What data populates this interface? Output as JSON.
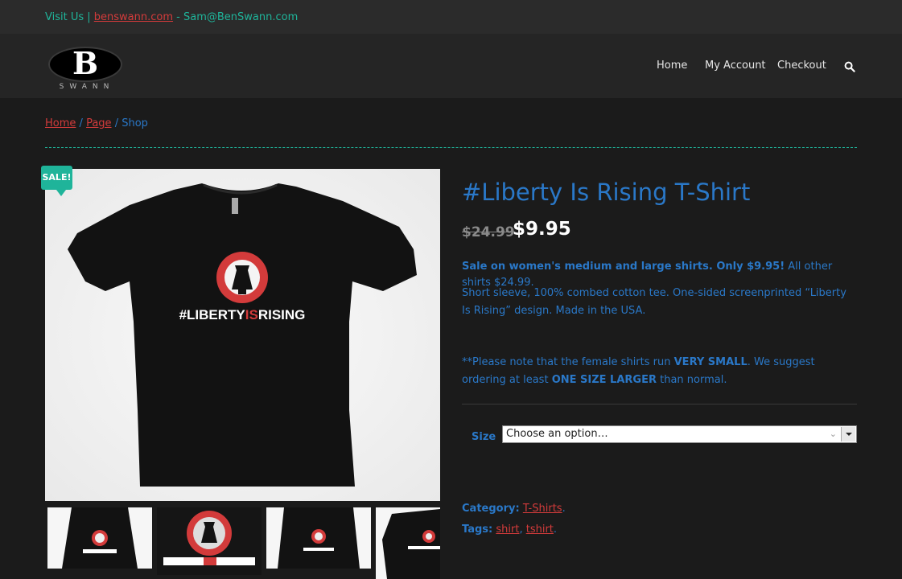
{
  "topbar": {
    "visit_label": "Visit Us |",
    "site_link": "benswann.com",
    "email": "- Sam@BenSwann.com"
  },
  "header": {
    "logo_letter": "B",
    "logo_text": "SWANN",
    "nav": [
      "Home",
      "My Account",
      "Checkout"
    ],
    "search_icon": "search-icon"
  },
  "breadcrumb": {
    "items": [
      "Home",
      "Page",
      "Shop"
    ],
    "separator": "/"
  },
  "product": {
    "badge": "SALE!",
    "title": "#Liberty Is Rising T-Shirt",
    "old_price": "$24.99",
    "price": "$9.95",
    "sale_bold": "Sale on women's medium and large shirts. Only $9.95!",
    "sale_rest": "All other shirts $24.99.",
    "description": "Short sleeve, 100% combed cotton tee. One-sided screenprinted “Liberty Is Rising” design. Made in the USA.",
    "note_a": "**Please note that the female shirts run",
    "note_b": "VERY SMALL",
    "note_c": ". We suggest ordering at least",
    "note_d": "ONE SIZE LARGER",
    "note_e": "than normal.",
    "size_label": "Size",
    "size_select": "Choose an option…",
    "category_label": "Category:",
    "category": "T-Shirts",
    "tags_label": "Tags:",
    "tags": [
      "shirt",
      "tshirt"
    ],
    "shirt_text": "#LIBERTYISRISING",
    "shirt_text_a": "#LIBERTY",
    "shirt_text_b": "IS",
    "shirt_text_c": "RISING"
  },
  "colors": {
    "accent_teal": "#1fb49a",
    "link_red": "#d33b3b",
    "text_blue": "#2a78c8",
    "background": "#1b1b1b"
  }
}
